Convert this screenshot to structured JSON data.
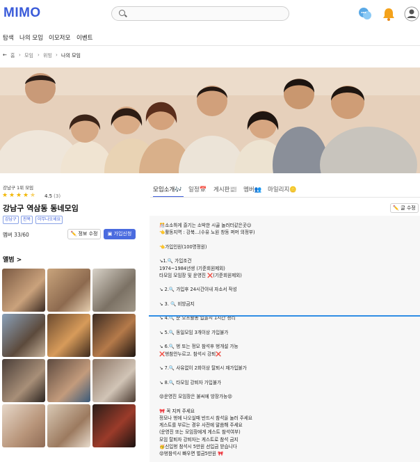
{
  "header": {
    "logo": "MIMO",
    "search_placeholder": "",
    "icons": [
      "chat-bubbles-icon",
      "bell-icon",
      "user-icon"
    ]
  },
  "nav": {
    "items": [
      "탐색",
      "나의 모임",
      "이모저모",
      "이벤트"
    ]
  },
  "breadcrumb": {
    "items": [
      "홈",
      "모임",
      "위빙",
      "나의 모임"
    ]
  },
  "group": {
    "rank": "강남구 1위 모임",
    "rating": "4.5",
    "rating_count": "(3)",
    "stars": 4.5,
    "title": "강남구 역삼동 동네모임",
    "tags": [
      "강남구",
      "친목",
      "아무나오세요"
    ],
    "members": "멤버 33/60",
    "edit_button": "정보 수정",
    "join_button": "가입신청"
  },
  "album": {
    "heading": "앨범 >",
    "photo_count": 12
  },
  "tabs": {
    "items": [
      "모임소개🎶",
      "일정📅",
      "게시판📰",
      "멤버👥",
      "마일리지🪙"
    ],
    "active_index": 0
  },
  "write_button": "글 수정",
  "post": {
    "lines": [
      "🎊소소하게 즐기는 소박한 시골 놀러터같은곳😉",
      "👈활동지역 : 강북...(수유 노원 창동 퍼머 의정부)",
      "",
      "👈가입인원(100명정원)",
      "",
      "↘1.🔍 가입조건",
      "1974~1984년생 (기준회원제외)",
      "타모임 모임장 및 운영진 ❌(기준회원제외)",
      "",
      "↘ 2.🔍 가입후 24시간이내 자소서 작성",
      "",
      "↘ 3. 🔍 비방금지",
      "",
      "↘ 4.🔍 순 오프활동 없을시 1시간 정리",
      "",
      "↘ 5.🔍 동일모임 3개이상 가입불가",
      "",
      "↘ 6.🔍 벙 또는 정모 참석후 벙개설 가능",
      "    ❌벙참안누르고. 참석시 강퇴❌",
      "",
      "↘ 7.🔍 사유없이 2회이상 탈퇴시 재가입불가",
      "",
      "↘ 8.🔍 타모임 강퇴자 가입불가",
      "",
      "😡운영진 모임장은 불씨에 방장가능😡",
      "",
      "🎀 꼭 지켜 주세요",
      "정모나 벙에 나오실때 반드시 참석을 눌러 주세요",
      "게스트를 부르는 경우 사전에 말씀해 주세요",
      "(운영진 또는 모임장에게 게스트 참석여부)",
      "모임 탈퇴자 강퇴자는 게스트로 참석 금지",
      "🥳신입벙 참석시 5만원 선입금 받습니다",
      "😡벙참석시 빠우면 벌금5만원 🎀"
    ]
  },
  "colors": {
    "brand": "#3a5bd9",
    "join_button": "#4a6bdf",
    "star": "#f2b705",
    "overlay_line": "#2f8de4"
  }
}
